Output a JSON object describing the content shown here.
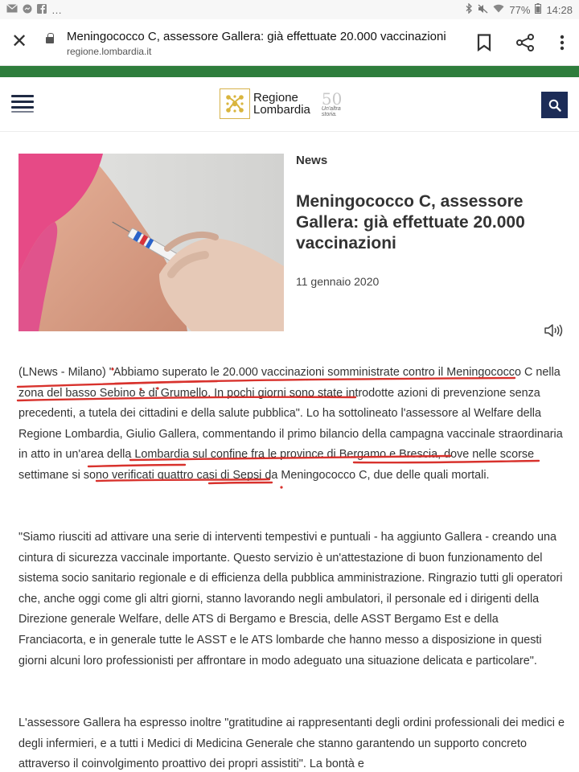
{
  "status_bar": {
    "left_icons": [
      "mail-icon",
      "messenger-icon",
      "facebook-icon"
    ],
    "left_ellipsis": "…",
    "battery": "77%",
    "time": "14:28"
  },
  "browser": {
    "title": "Meningococco C, assessore Gallera: già effettuate 20.000 vaccinazioni",
    "url": "regione.lombardia.it"
  },
  "site": {
    "logo_line1": "Regione",
    "logo_line2": "Lombardia",
    "anniversary_number": "50",
    "anniversary_sub": "Un'altra storia.",
    "accent_green": "#2e7d3c",
    "accent_navy": "#1c2c57"
  },
  "article": {
    "category": "News",
    "headline": "Meningococco C, assessore Gallera: già effettuate 20.000 vaccinazioni",
    "date": "11 gennaio 2020",
    "paragraphs": [
      "(LNews - Milano) \"Abbiamo superato le 20.000 vaccinazioni somministrate contro il Meningococco C nella zona del basso Sebino e di Grumello. In pochi giorni sono state introdotte azioni di prevenzione senza precedenti, a tutela dei cittadini e della salute pubblica\". Lo ha sottolineato l'assessore al Welfare della Regione Lombardia, Giulio Gallera, commentando il primo bilancio della campagna vaccinale straordinaria in atto in un'area della Lombardia sul confine fra le province di Bergamo e Brescia, dove nelle scorse settimane si sono verificati quattro casi di Sepsi da Meningococco C, due delle quali mortali.",
      "\"Siamo riusciti ad attivare una serie di interventi tempestivi e puntuali - ha aggiunto Gallera - creando una cintura di sicurezza vaccinale importante. Questo servizio è un'attestazione di buon funzionamento del sistema socio sanitario regionale e di efficienza della pubblica amministrazione. Ringrazio tutti gli operatori che, anche oggi come gli altri giorni, stanno lavorando negli ambulatori, il personale ed i dirigenti della Direzione generale Welfare, delle ATS di Bergamo e Brescia, delle ASST Bergamo Est e della Franciacorta, e in generale tutte le ASST e le ATS lombarde che hanno messo a disposizione in questi giorni alcuni loro professionisti per affrontare in modo adeguato una situazione delicata e particolare\".",
      "L'assessore Gallera ha espresso inoltre \"gratitudine ai rappresentanti degli ordini professionali dei medici e degli infermieri, e a tutti i Medici di Medicina Generale che stanno garantendo un supporto concreto attraverso il coinvolgimento proattivo dei propri assistiti\". La bontà e"
    ]
  }
}
